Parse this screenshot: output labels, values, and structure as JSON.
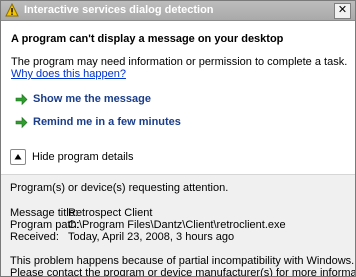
{
  "window": {
    "title": "Interactive services dialog detection",
    "close_glyph": "✕"
  },
  "message": {
    "heading": "A program can't display a message on your desktop",
    "description": "The program may need information or permission to complete a task.",
    "why_link": "Why does this happen?"
  },
  "actions": [
    {
      "label": "Show me the message",
      "icon": "green-arrow-icon"
    },
    {
      "label": "Remind me in a few minutes",
      "icon": "green-arrow-icon"
    }
  ],
  "details": {
    "toggle_label": "Hide program details",
    "intro": "Program(s) or device(s) requesting attention.",
    "message_title_label": "Message title:",
    "message_title_value": "Retrospect Client",
    "program_path_label": "Program path:",
    "program_path_value": "C:\\Program Files\\Dantz\\Client\\retroclient.exe",
    "received_label": "Received:",
    "received_value": "Today, April 23, 2008, 3 hours ago",
    "note_line1": "This problem happens because of partial incompatibility with Windows.",
    "note_line2": "Please contact the program or device manufacturer(s) for more information."
  },
  "colors": {
    "arrow_green": "#2f9e2f",
    "link_blue": "#0033cc"
  }
}
